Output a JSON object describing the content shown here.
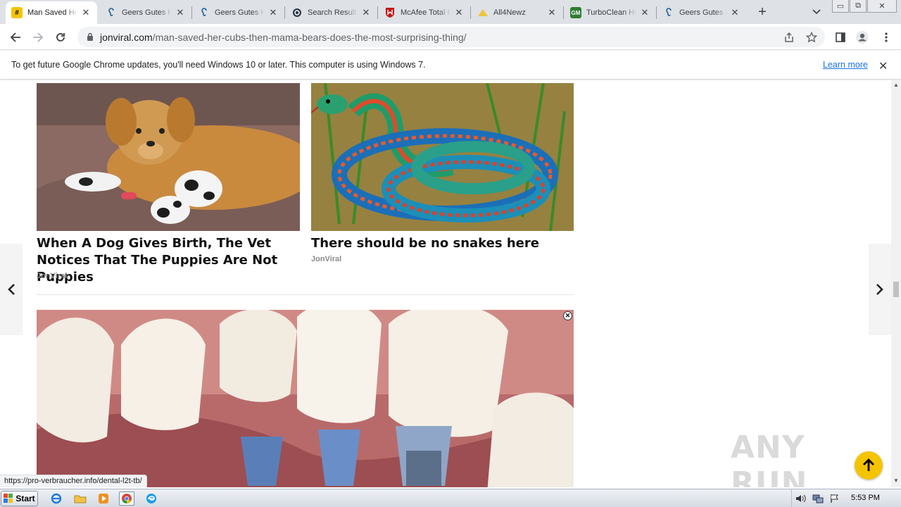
{
  "browser": {
    "tabs": [
      {
        "title": "Man Saved Her Cubs Then Mama Bears",
        "favicon": "hash-icon",
        "active": true
      },
      {
        "title": "Geers Gutes Hören",
        "favicon": "ear-icon"
      },
      {
        "title": "Geers Gutes Hören",
        "favicon": "ear-icon"
      },
      {
        "title": "Search Results",
        "favicon": "search-results-icon"
      },
      {
        "title": "McAfee Total Protection",
        "favicon": "mcafee-shield-icon"
      },
      {
        "title": "All4Newz",
        "favicon": "bell-icon"
      },
      {
        "title": "TurboClean Health",
        "favicon": "gm-icon"
      },
      {
        "title": "Geers Gutes Hören",
        "favicon": "ear-icon"
      }
    ],
    "url_host": "jonviral.com",
    "url_path": "/man-saved-her-cubs-then-mama-bears-does-the-most-surprising-thing/",
    "infobar": {
      "message": "To get future Google Chrome updates, you'll need Windows 10 or later. This computer is using Windows 7.",
      "link": "Learn more"
    },
    "status_url": "https://pro-verbraucher.info/dental-l2t-tb/"
  },
  "content": {
    "cards": [
      {
        "headline": "When A Dog Gives Birth, The Vet Notices That The Puppies Are Not Puppies",
        "source": "JonViral"
      },
      {
        "headline": "There should be no snakes here",
        "source": "JonViral"
      }
    ],
    "watermark": "ANY RUN"
  },
  "taskbar": {
    "start_label": "Start",
    "clock": "5:53 PM"
  },
  "colors": {
    "accent": "#f5c400",
    "link": "#1a73e8"
  }
}
